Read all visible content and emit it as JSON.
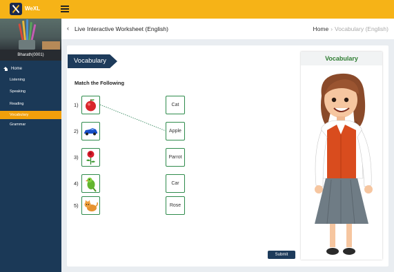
{
  "app": {
    "logo_text": "WeXL"
  },
  "user": {
    "name": "Bharath(0001)"
  },
  "sidebar": {
    "items": [
      {
        "label": "Home"
      },
      {
        "label": "Listening"
      },
      {
        "label": "Speaking"
      },
      {
        "label": "Reading"
      },
      {
        "label": "Vocabulary",
        "active": true
      },
      {
        "label": "Grammar"
      }
    ]
  },
  "header": {
    "title": "Live Interactive Worksheet (English)",
    "breadcrumb": {
      "home": "Home",
      "separator": "›",
      "current": "Vocabulary (English)"
    }
  },
  "worksheet": {
    "banner": "Vocabulary",
    "instruction": "Match the Following",
    "questions": [
      {
        "number": "1)",
        "image": "apple-icon"
      },
      {
        "number": "2)",
        "image": "car-icon"
      },
      {
        "number": "3)",
        "image": "rose-icon"
      },
      {
        "number": "4)",
        "image": "parrot-icon"
      },
      {
        "number": "5)",
        "image": "cat-icon"
      }
    ],
    "answers": [
      "Cat",
      "Apple",
      "Parrot",
      "Car",
      "Rose"
    ],
    "connections": [
      {
        "from": 1,
        "to": 2
      }
    ],
    "submit_label": "Submit"
  },
  "right_panel": {
    "title": "Vocabulary"
  },
  "colors": {
    "accent": "#f6b317",
    "navy": "#1b3957",
    "active_nav": "#f29f0b",
    "box_border": "#2d8a4a"
  }
}
